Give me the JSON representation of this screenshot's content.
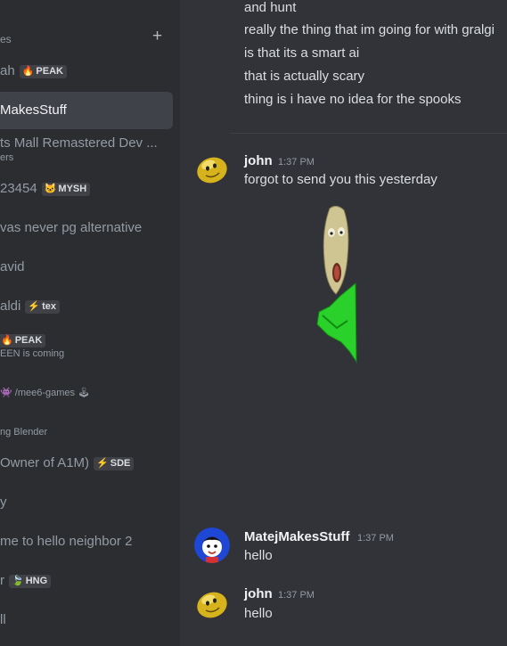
{
  "sidebar": {
    "header_label": "es",
    "add_icon": "plus-icon",
    "items": [
      {
        "name": "ah",
        "tag": {
          "icon": "🔥",
          "text": "PEAK"
        }
      },
      {
        "name": "MakesStuff"
      },
      {
        "name": "ts Mall Remastered Dev ...",
        "sub": "ers"
      },
      {
        "name": "23454",
        "tag": {
          "icon": "🐱",
          "text": "MYSH"
        }
      },
      {
        "name": "vas never pg alternative"
      },
      {
        "name": "avid"
      },
      {
        "name": "aldi",
        "tag": {
          "icon": "⚡",
          "text": "tex"
        }
      },
      {
        "name": "",
        "tag": {
          "icon": "🔥",
          "text": "PEAK"
        },
        "sub": "EEN is coming"
      },
      {
        "sub": "/mee6-games",
        "sub_icon_left": "👾",
        "sub_icon_right": "🕹"
      },
      {
        "sub": "ng Blender"
      },
      {
        "name": "Owner of A1M)",
        "tag": {
          "icon": "⚡",
          "text": "SDE"
        }
      },
      {
        "name": "y"
      },
      {
        "name": "me to hello neighbor 2"
      },
      {
        "name": "r",
        "tag": {
          "icon": "🍃",
          "text": "HNG"
        }
      },
      {
        "name": "ll"
      }
    ]
  },
  "chat": {
    "previous_lines": [
      "and hunt",
      "really the thing that im going for with gralgi",
      "is that its a smart ai",
      "that is actually scary",
      "thing is i have no idea for the spooks"
    ],
    "messages": [
      {
        "author": "john",
        "time": "1:37 PM",
        "text": "forgot to send you this yesterday",
        "avatar": "yellow-bean-avatar"
      },
      {
        "author": "MatejMakesStuff",
        "time": "1:37 PM",
        "text": "hello",
        "avatar": "blue-face-avatar"
      },
      {
        "author": "john",
        "time": "1:37 PM",
        "text": "hello",
        "avatar": "yellow-bean-avatar"
      }
    ]
  },
  "colors": {
    "background": "#313338",
    "sidebar": "#2b2d31",
    "selected": "#404249",
    "text": "#dbdee1",
    "muted": "#949ba4"
  }
}
